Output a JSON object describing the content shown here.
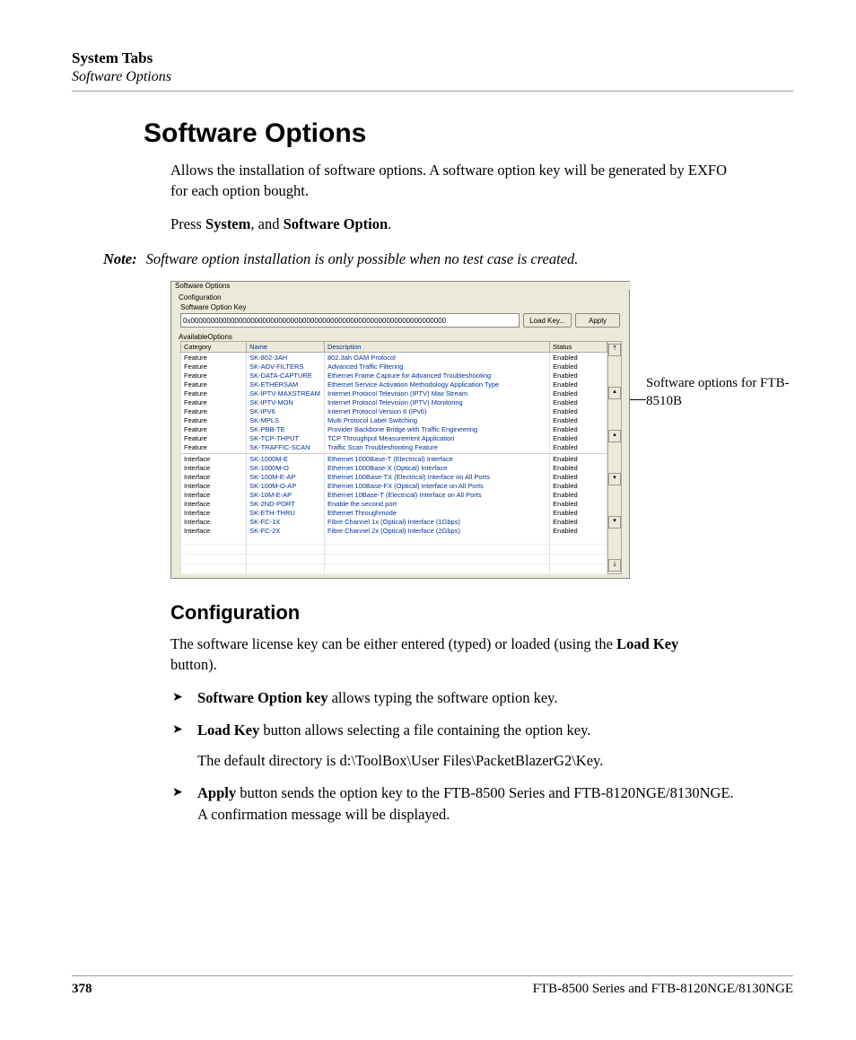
{
  "header": {
    "chapter": "System Tabs",
    "section": "Software Options"
  },
  "heading": "Software Options",
  "para1": "Allows the installation of software options. A software option key will be generated by EXFO for each option bought.",
  "para2_pre": "Press ",
  "para2_b1": "System",
  "para2_mid": ", and ",
  "para2_b2": "Software Option",
  "para2_end": ".",
  "note_label": "Note:",
  "note_text": "Software option installation is only possible when no test case is created.",
  "panel": {
    "title": "Software Options",
    "config_label": "Configuration",
    "key_label": "Software Option Key",
    "key_value": "0x0000000000000000000000000000000000000000000000000000000000000000",
    "load_btn": "Load Key...",
    "apply_btn": "Apply",
    "avail_label": "AvailableOptions",
    "cols": {
      "c1": "Category",
      "c2": "Name",
      "c3": "Description",
      "c4": "Status"
    },
    "rows1": [
      {
        "cat": "Feature",
        "name": "SK-802-3AH",
        "desc": "802.3ah OAM Protocol",
        "stat": "Enabled"
      },
      {
        "cat": "Feature",
        "name": "SK-ADV-FILTERS",
        "desc": "Advanced Traffic Filtering",
        "stat": "Enabled"
      },
      {
        "cat": "Feature",
        "name": "SK-DATA-CAPTURE",
        "desc": "Ethernet Frame Capture for Advanced Troubleshooting",
        "stat": "Enabled"
      },
      {
        "cat": "Feature",
        "name": "SK-ETHERSAM",
        "desc": "Ethernet Service Activation Methodology Application Type",
        "stat": "Enabled"
      },
      {
        "cat": "Feature",
        "name": "SK-IPTV-MAXSTREAM",
        "desc": "Internet Protocol Television (IPTV) Max Stream",
        "stat": "Enabled"
      },
      {
        "cat": "Feature",
        "name": "SK-IPTV-MON",
        "desc": "Internet Protocol Television (IPTV) Monitoring",
        "stat": "Enabled"
      },
      {
        "cat": "Feature",
        "name": "SK-IPV6",
        "desc": "Internet Protocol Version 6 (IPv6)",
        "stat": "Enabled"
      },
      {
        "cat": "Feature",
        "name": "SK-MPLS",
        "desc": "Multi Protocol Label Switching",
        "stat": "Enabled"
      },
      {
        "cat": "Feature",
        "name": "SK-PBB-TE",
        "desc": "Provider Backbone Bridge with Traffic Engineering",
        "stat": "Enabled"
      },
      {
        "cat": "Feature",
        "name": "SK-TCP-THPUT",
        "desc": "TCP Throughput Measurement Application",
        "stat": "Enabled"
      },
      {
        "cat": "Feature",
        "name": "SK-TRAFFIC-SCAN",
        "desc": "Traffic Scan Troubleshooting Feature",
        "stat": "Enabled"
      }
    ],
    "rows2": [
      {
        "cat": "Interface",
        "name": "SK-1000M-E",
        "desc": "Ethernet 1000Base-T (Electrical) Interface",
        "stat": "Enabled"
      },
      {
        "cat": "Interface",
        "name": "SK-1000M-O",
        "desc": "Ethernet 1000Base-X (Optical) Interface",
        "stat": "Enabled"
      },
      {
        "cat": "Interface",
        "name": "SK-100M-E-AP",
        "desc": "Ethernet 100Base-TX (Electrical) Interface on All Ports",
        "stat": "Enabled"
      },
      {
        "cat": "Interface",
        "name": "SK-100M-O-AP",
        "desc": "Ethernet 100Base-FX (Optical) Interface on All Ports",
        "stat": "Enabled"
      },
      {
        "cat": "Interface",
        "name": "SK-10M-E-AP",
        "desc": "Ethernet 10Base-T (Electrical) Interface on All Ports",
        "stat": "Enabled"
      },
      {
        "cat": "Interface",
        "name": "SK-2ND-PORT",
        "desc": "Enable the second port",
        "stat": "Enabled"
      },
      {
        "cat": "Interface",
        "name": "SK-ETH-THRU",
        "desc": "Ethernet Throughmode",
        "stat": "Enabled"
      },
      {
        "cat": "Interface",
        "name": "SK-FC-1X",
        "desc": "Fibre Channel 1x (Optical) Interface (1Gbps)",
        "stat": "Enabled"
      },
      {
        "cat": "Interface",
        "name": "SK-FC-2X",
        "desc": "Fibre Channel 2x (Optical) Interface (2Gbps)",
        "stat": "Enabled"
      }
    ]
  },
  "callout": "Software options for FTB-8510B",
  "sub_heading": "Configuration",
  "config_para_pre": "The software license key can be either entered (typed) or loaded (using the ",
  "config_para_b": "Load Key",
  "config_para_end": " button).",
  "bullets": [
    {
      "b": "Software Option key",
      "rest": " allows typing the software option key."
    },
    {
      "b": "Load Key",
      "rest": " button allows selecting a file containing the option key.",
      "extra": "The default directory is d:\\ToolBox\\User Files\\PacketBlazerG2\\Key."
    },
    {
      "b": "Apply",
      "rest": " button sends the option key to the FTB-8500 Series and FTB-8120NGE/8130NGE. A confirmation message will be displayed."
    }
  ],
  "footer": {
    "page": "378",
    "doc": "FTB-8500 Series and FTB-8120NGE/8130NGE"
  }
}
